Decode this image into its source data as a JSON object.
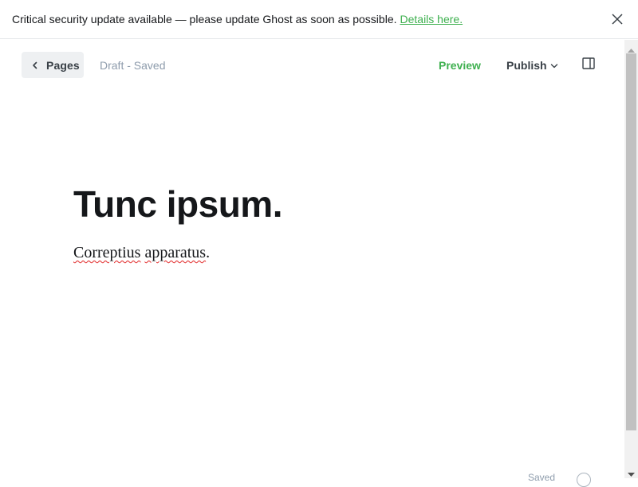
{
  "banner": {
    "message": "Critical security update available — please update Ghost as soon as possible.",
    "link_text": "Details here.",
    "close_icon": "close-icon"
  },
  "header": {
    "back_label": "Pages",
    "back_icon": "chevron-left-icon",
    "status": "Draft - Saved",
    "preview_label": "Preview",
    "publish_label": "Publish",
    "publish_icon": "chevron-down-icon",
    "sidebar_icon": "sidebar-toggle-icon"
  },
  "editor": {
    "title": "Tunc ipsum.",
    "body_words": [
      "Correptius",
      "apparatus"
    ],
    "body_punct": "."
  },
  "footer": {
    "help_text": "Saved"
  },
  "colors": {
    "accent_green": "#3eb04f",
    "text_dark": "#15171a",
    "muted": "#8e9cac",
    "button_bg": "#eef0f2",
    "spellcheck": "#e02020"
  }
}
